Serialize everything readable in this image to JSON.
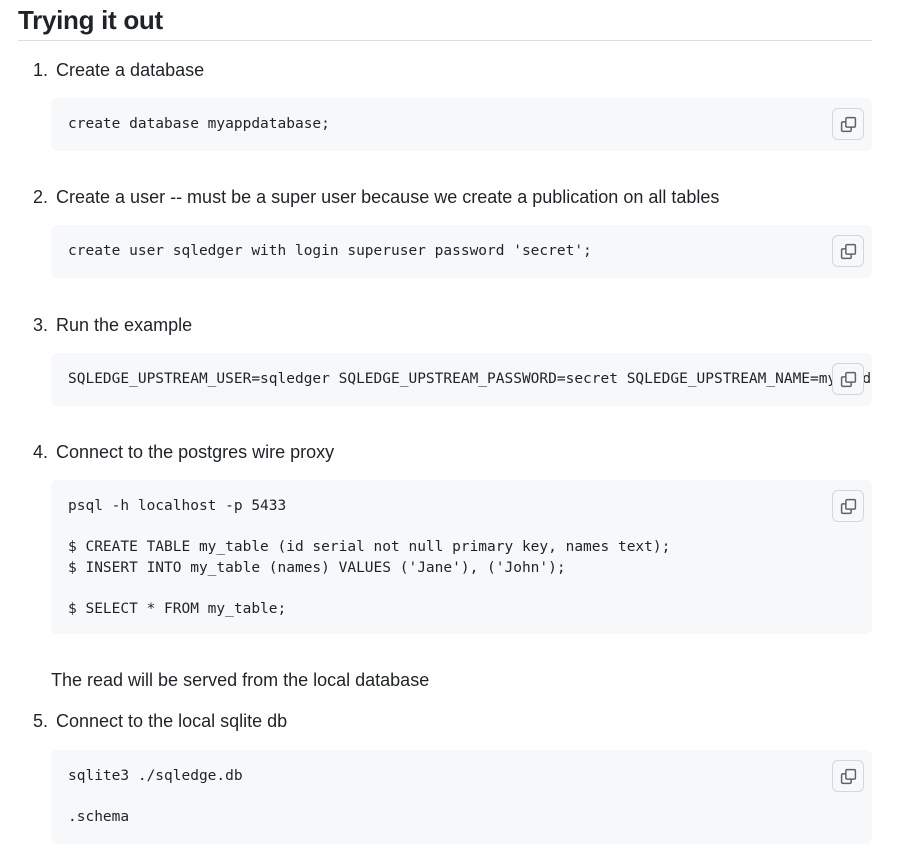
{
  "heading": {
    "title": "Trying it out"
  },
  "steps": [
    {
      "number": "1.",
      "label": "Create a database",
      "code": "create database myappdatabase;"
    },
    {
      "number": "2.",
      "label": "Create a user -- must be a super user because we create a publication on all tables",
      "code": "create user sqledger with login superuser password 'secret';"
    },
    {
      "number": "3.",
      "label": "Run the example",
      "code": "SQLEDGE_UPSTREAM_USER=sqledger SQLEDGE_UPSTREAM_PASSWORD=secret SQLEDGE_UPSTREAM_NAME=myappdatab"
    },
    {
      "number": "4.",
      "label": "Connect to the postgres wire proxy",
      "code": "psql -h localhost -p 5433\n\n$ CREATE TABLE my_table (id serial not null primary key, names text);\n$ INSERT INTO my_table (names) VALUES ('Jane'), ('John');\n\n$ SELECT * FROM my_table;"
    },
    {
      "number": "5.",
      "label": "Connect to the local sqlite db",
      "code": "sqlite3 ./sqledge.db\n\n.schema"
    }
  ],
  "note": "The read will be served from the local database",
  "icons": {
    "copy": "copy-icon"
  },
  "colors": {
    "code_background": "#f6f8fa",
    "border": "#d0d7de",
    "text": "#1f2328"
  }
}
